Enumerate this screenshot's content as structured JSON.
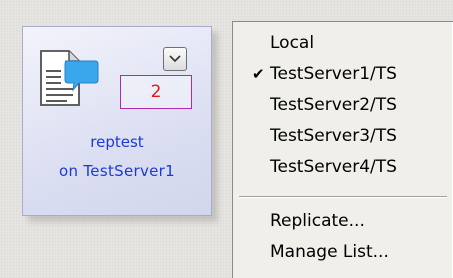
{
  "tile": {
    "count": "2",
    "db_name": "reptest",
    "server_label": "on TestServer1",
    "icon": "document-chat-icon",
    "dropdown_icon": "chevron-down-icon"
  },
  "menu": {
    "items": [
      {
        "label": "Local",
        "checked": false
      },
      {
        "label": "TestServer1/TS",
        "checked": true
      },
      {
        "label": "TestServer2/TS",
        "checked": false
      },
      {
        "label": "TestServer3/TS",
        "checked": false
      },
      {
        "label": "TestServer4/TS",
        "checked": false
      }
    ],
    "actions": [
      {
        "label": "Replicate..."
      },
      {
        "label": "Manage List..."
      }
    ],
    "check_glyph": "✔"
  },
  "colors": {
    "link_blue": "#1a3ad8",
    "count_red": "#e8121a",
    "count_border": "#b02ab0",
    "icon_blue": "#3aa6ec"
  }
}
